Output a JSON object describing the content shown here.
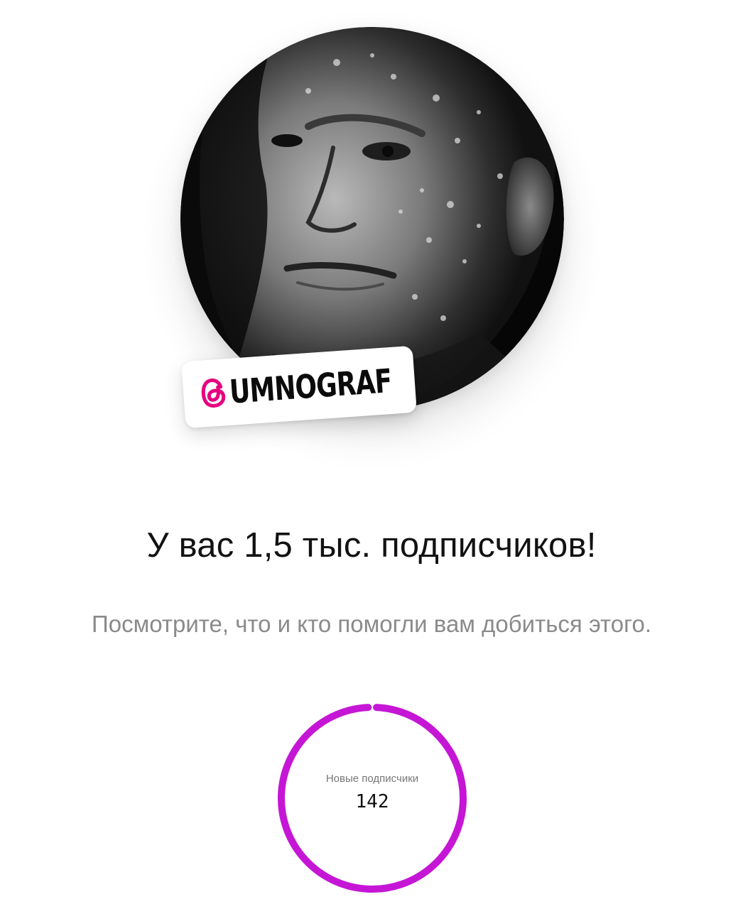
{
  "profile": {
    "handle": "UMNOGRAF",
    "avatar_icon": "profile-photo-monochrome"
  },
  "headline": "У вас 1,5 тыс. подписчиков!",
  "subtitle": "Посмотрите, что и кто помогли вам добиться этого.",
  "stats": {
    "label": "Новые подписчики",
    "value": "142",
    "ring_fill": 0.985,
    "ring_color": "#c516d6"
  },
  "colors": {
    "threads_icon": "#e6007e",
    "subtitle": "#8a8a8a"
  }
}
